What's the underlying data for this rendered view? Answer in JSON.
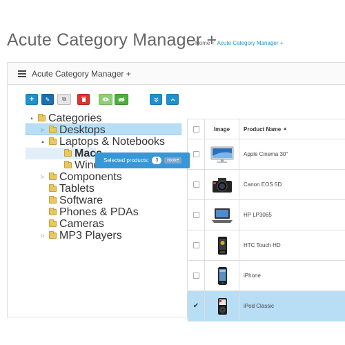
{
  "header": {
    "title": "Acute Category Manager +",
    "breadcrumb": [
      "Home",
      "Acute Category Manager +"
    ]
  },
  "panel": {
    "title": "Acute Category Manager +"
  },
  "toolbar": {
    "buttons": [
      {
        "name": "add-button",
        "glyph": "+",
        "icon": "plus-icon",
        "color": "#1e91cf"
      },
      {
        "name": "edit-button",
        "glyph": "✎",
        "icon": "pencil-icon",
        "color": "#1b6fb0"
      },
      {
        "name": "copy-button",
        "glyph": "⧉",
        "icon": "copy-icon",
        "color": "#e6e6e6"
      },
      {
        "name": "delete-button",
        "glyph": "🗑",
        "icon": "trash-icon",
        "color": "#e0322c"
      },
      {
        "name": "show-button",
        "glyph": "◉",
        "icon": "eye-icon",
        "color": "#8fcf76"
      },
      {
        "name": "hide-button",
        "glyph": "◉",
        "icon": "eye-slash-icon",
        "color": "#4cae3b"
      },
      {
        "name": "collapse-button",
        "glyph": "»",
        "icon": "angle-double-down-icon",
        "color": "#1e91cf"
      },
      {
        "name": "expand-button",
        "glyph": "⌃",
        "icon": "angle-up-icon",
        "color": "#1e91cf"
      }
    ]
  },
  "tree": {
    "items": [
      {
        "label": "Categories",
        "toggle": "▲",
        "level": 0
      },
      {
        "label": "Desktops",
        "toggle": "▷",
        "level": 1,
        "selected": true
      },
      {
        "label": "Laptops & Notebooks",
        "toggle": "▲",
        "level": 1
      },
      {
        "label": "Macs",
        "toggle": "",
        "level": 2,
        "bold": true
      },
      {
        "label": "Windows",
        "toggle": "",
        "level": 2
      },
      {
        "label": "Components",
        "toggle": "▷",
        "level": 1
      },
      {
        "label": "Tablets",
        "toggle": "",
        "level": 1
      },
      {
        "label": "Software",
        "toggle": "",
        "level": 1
      },
      {
        "label": "Phones & PDAs",
        "toggle": "",
        "level": 1
      },
      {
        "label": "Cameras",
        "toggle": "",
        "level": 1
      },
      {
        "label": "MP3 Players",
        "toggle": "▷",
        "level": 1
      }
    ]
  },
  "popup": {
    "label": "Selected products:",
    "count": "3",
    "action": "move"
  },
  "products": {
    "headers": {
      "image": "Image",
      "name": "Product Name",
      "sort": "▲"
    },
    "rows": [
      {
        "name": "Apple Cinema 30\"",
        "image_icon": "monitor-image",
        "checked": false
      },
      {
        "name": "Canon EOS 5D",
        "image_icon": "camera-image",
        "checked": false
      },
      {
        "name": "HP LP3065",
        "image_icon": "laptop-image",
        "checked": false
      },
      {
        "name": "HTC Touch HD",
        "image_icon": "phone-image",
        "checked": false
      },
      {
        "name": "iPhone",
        "image_icon": "iphone-image",
        "checked": false
      },
      {
        "name": "iPod Classic",
        "image_icon": "ipod-image",
        "checked": true
      }
    ],
    "check_glyph": "✔"
  },
  "colors": {
    "accent": "#1e91cf",
    "selected_row": "#b7def5",
    "popup": "#3897d6"
  }
}
